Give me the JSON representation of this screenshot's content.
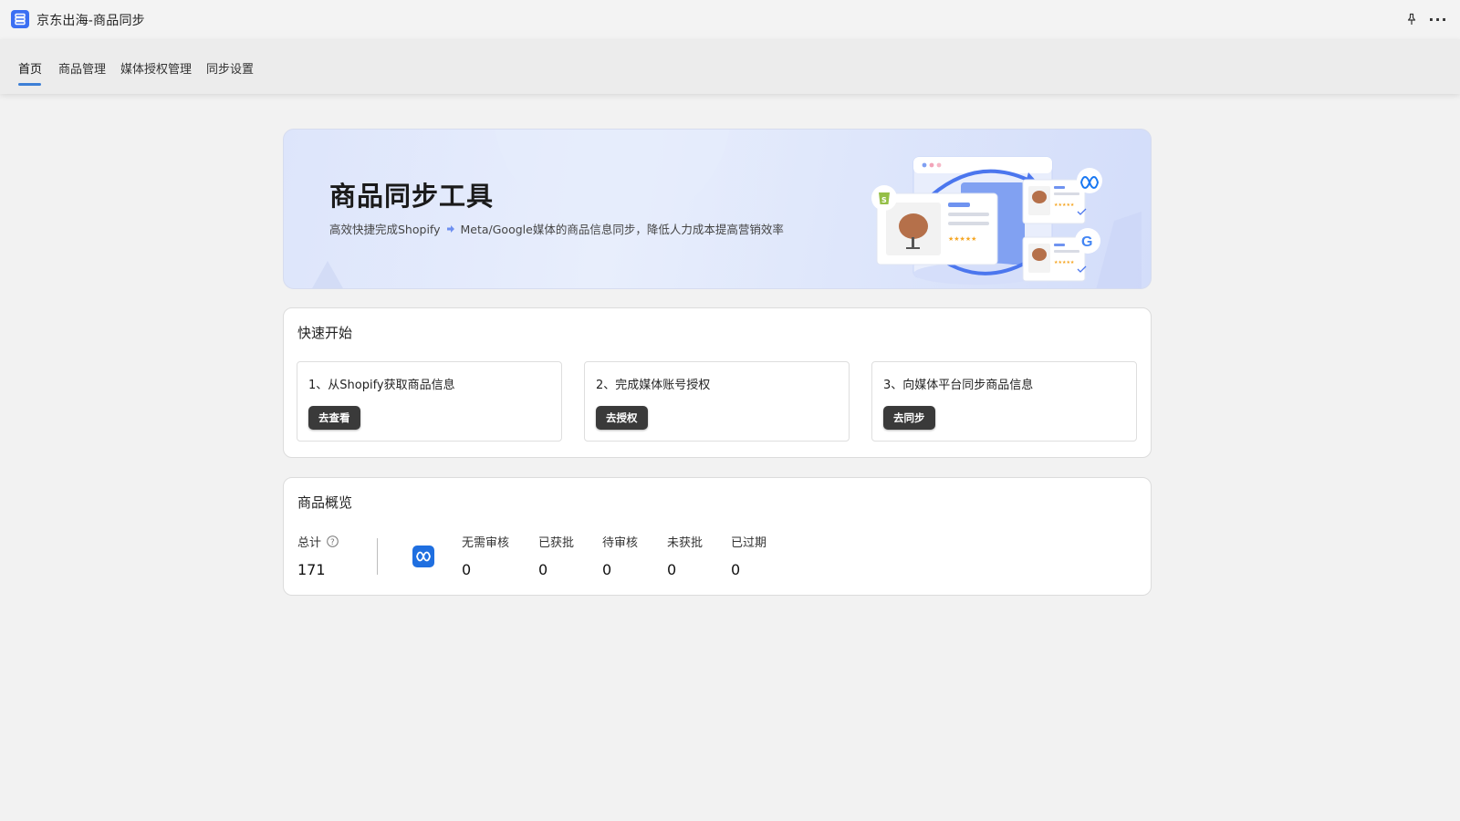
{
  "app": {
    "title": "京东出海-商品同步",
    "icon": "app-logo-icon"
  },
  "titlebar_actions": {
    "pin_icon": "pin-icon",
    "more_label": "···"
  },
  "nav": {
    "tabs": [
      {
        "label": "首页",
        "active": true
      },
      {
        "label": "商品管理",
        "active": false
      },
      {
        "label": "媒体授权管理",
        "active": false
      },
      {
        "label": "同步设置",
        "active": false
      }
    ],
    "accent": "#3d7fd6"
  },
  "banner": {
    "title": "商品同步工具",
    "subtitle_before": "高效快捷完成Shopify",
    "subtitle_after": "Meta/Google媒体的商品信息同步，降低人力成本提高营销效率"
  },
  "quick_start": {
    "title": "快速开始",
    "steps": [
      {
        "text": "1、从Shopify获取商品信息",
        "button": "去查看"
      },
      {
        "text": "2、完成媒体账号授权",
        "button": "去授权"
      },
      {
        "text": "3、向媒体平台同步商品信息",
        "button": "去同步"
      }
    ]
  },
  "overview": {
    "title": "商品概览",
    "total_label": "总计",
    "total_value": "171",
    "platform_icon": "meta-icon",
    "stats": [
      {
        "label": "无需审核",
        "value": "0"
      },
      {
        "label": "已获批",
        "value": "0"
      },
      {
        "label": "待审核",
        "value": "0"
      },
      {
        "label": "未获批",
        "value": "0"
      },
      {
        "label": "已过期",
        "value": "0"
      }
    ]
  }
}
